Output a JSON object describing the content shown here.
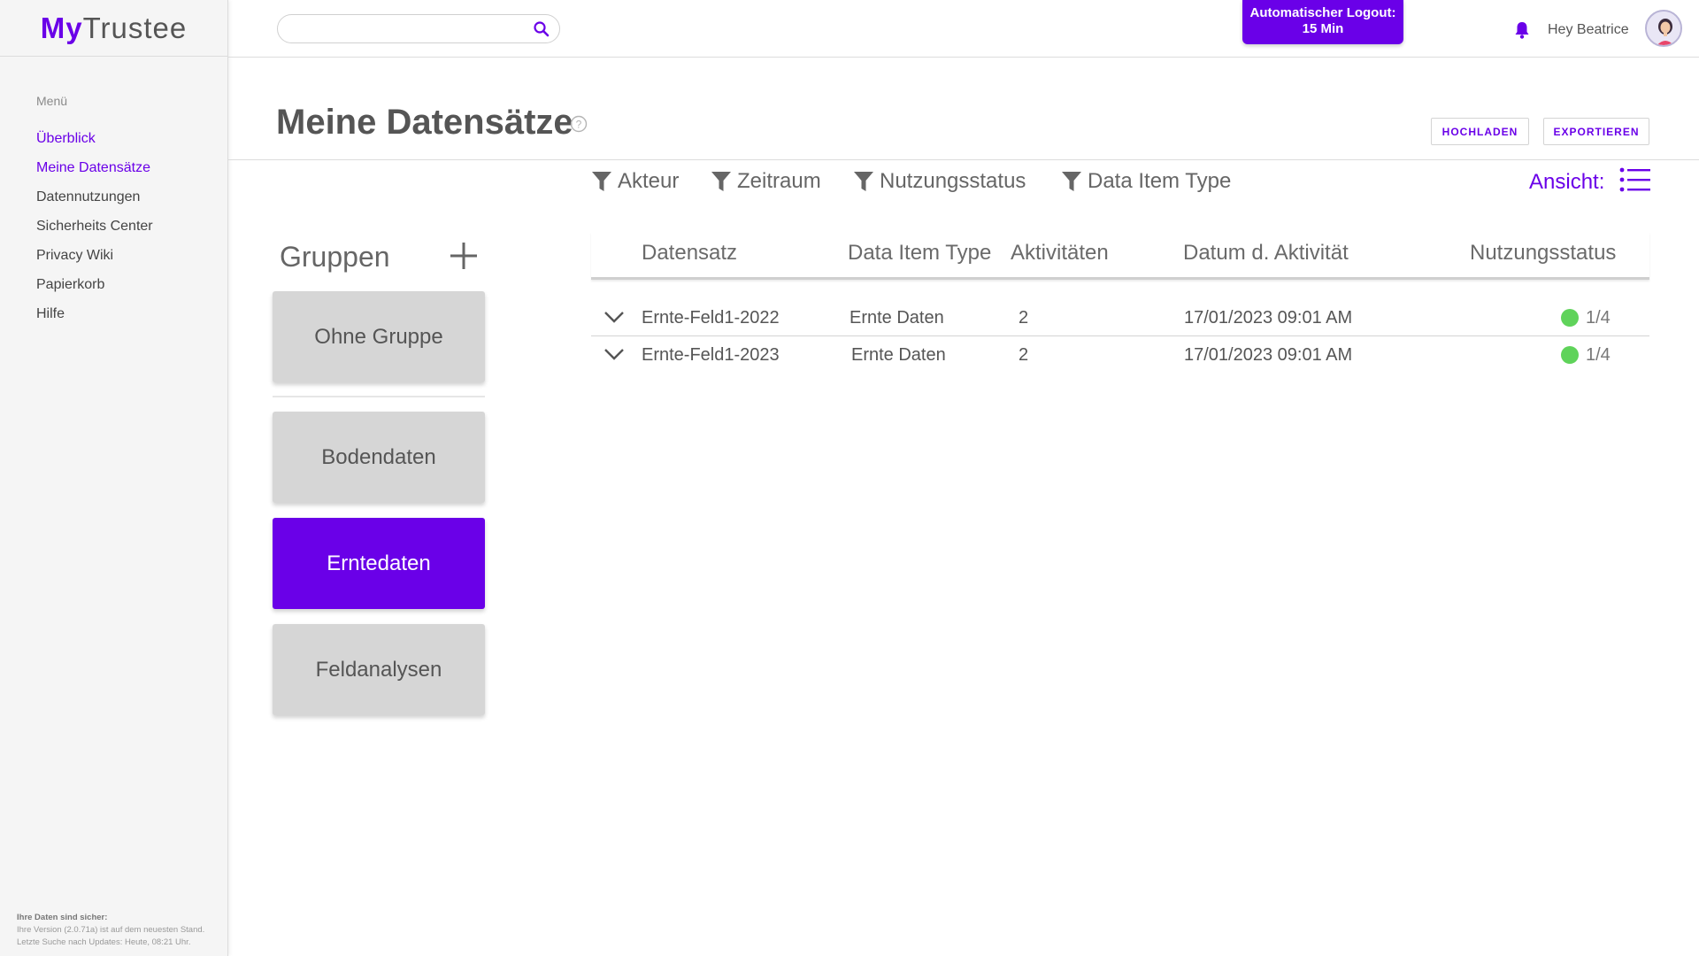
{
  "app": {
    "logo_my": "My",
    "logo_rest": "Trustee"
  },
  "sidebar": {
    "menu_heading": "Menü",
    "items": [
      {
        "label": "Überblick",
        "active": true
      },
      {
        "label": "Meine Datensätze",
        "active": true
      },
      {
        "label": "Datennutzungen",
        "active": false
      },
      {
        "label": "Sicherheits Center",
        "active": false
      },
      {
        "label": "Privacy Wiki",
        "active": false
      },
      {
        "label": "Papierkorb",
        "active": false
      },
      {
        "label": "Hilfe",
        "active": false
      }
    ],
    "footer": {
      "line1": "Ihre Daten sind sicher:",
      "line2": "Ihre Version (2.0.71a) ist auf dem neuesten Stand.",
      "line3": "Letzte Suche nach Updates: Heute, 08:21 Uhr."
    }
  },
  "topbar": {
    "search_placeholder": "",
    "search_value": "",
    "logout_line1": "Automatischer Logout:",
    "logout_line2": "15 Min",
    "greeting": "Hey Beatrice"
  },
  "header": {
    "title": "Meine Datensätze",
    "upload_label": "HOCHLADEN",
    "export_label": "EXPORTIEREN"
  },
  "filters": {
    "actor": "Akteur",
    "period": "Zeitraum",
    "usage_status": "Nutzungsstatus",
    "item_type": "Data Item Type",
    "view_label": "Ansicht:"
  },
  "groups": {
    "title": "Gruppen",
    "items": [
      {
        "label": "Ohne Gruppe",
        "active": false
      },
      {
        "label": "Bodendaten",
        "active": false
      },
      {
        "label": "Erntedaten",
        "active": true
      },
      {
        "label": "Feldanalysen",
        "active": false
      }
    ]
  },
  "table": {
    "headers": {
      "dataset": "Datensatz",
      "item_type": "Data Item Type",
      "activities": "Aktivitäten",
      "date": "Datum d. Aktivität",
      "status": "Nutzungsstatus"
    },
    "rows": [
      {
        "dataset": "Ernte-Feld1-2022",
        "item_type": "Ernte Daten",
        "activities": "2",
        "date": "17/01/2023 09:01 AM",
        "status": "1/4",
        "status_color": "#5fd35a"
      },
      {
        "dataset": "Ernte-Feld1-2023",
        "item_type": "Ernte Daten",
        "activities": "2",
        "date": "17/01/2023 09:01 AM",
        "status": "1/4",
        "status_color": "#5fd35a"
      }
    ]
  },
  "colors": {
    "accent": "#6a00e8",
    "status_ok": "#5fd35a",
    "card_grey": "#d6d6d6"
  }
}
